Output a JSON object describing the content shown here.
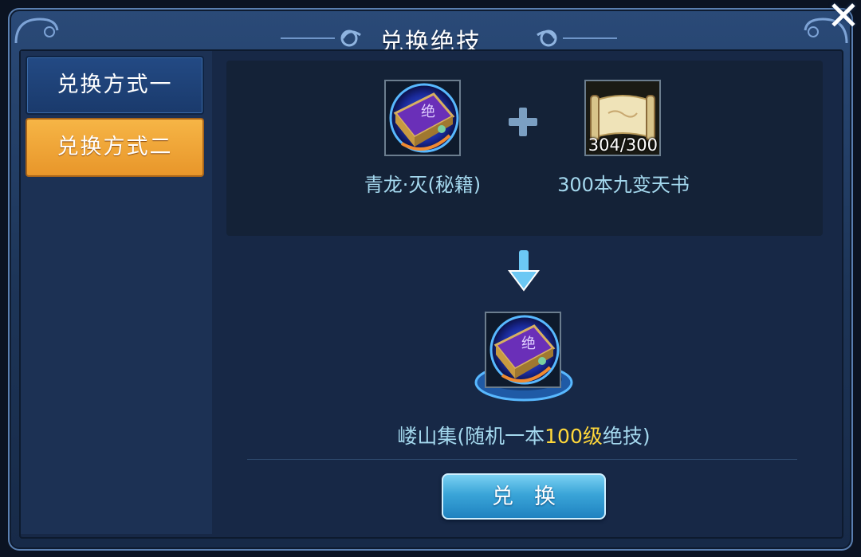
{
  "dialog": {
    "title": "兑换绝技",
    "close_label": "✕"
  },
  "sidebar": {
    "tabs": [
      {
        "label": "兑换方式一",
        "active": false
      },
      {
        "label": "兑换方式二",
        "active": true
      }
    ]
  },
  "recipe": {
    "ingredient_1": {
      "label": "青龙·灭(秘籍)",
      "icon": "purple-skill-book-icon"
    },
    "ingredient_2": {
      "label": "300本九变天书",
      "icon": "scroll-icon",
      "count": "304/300"
    },
    "plus_icon": "plus-icon",
    "arrow_icon": "down-arrow-icon"
  },
  "result": {
    "icon": "purple-skill-book-icon",
    "label_prefix": "嵝山集(随机一本",
    "label_highlight": "100级",
    "label_suffix": "绝技)"
  },
  "actions": {
    "exchange_label": "兑换"
  },
  "colors": {
    "active_tab": "#f0a836",
    "inactive_tab": "#1f4377",
    "label_text": "#a4d8ee",
    "highlight": "#ffd83a",
    "button": "#3aa5d8"
  }
}
